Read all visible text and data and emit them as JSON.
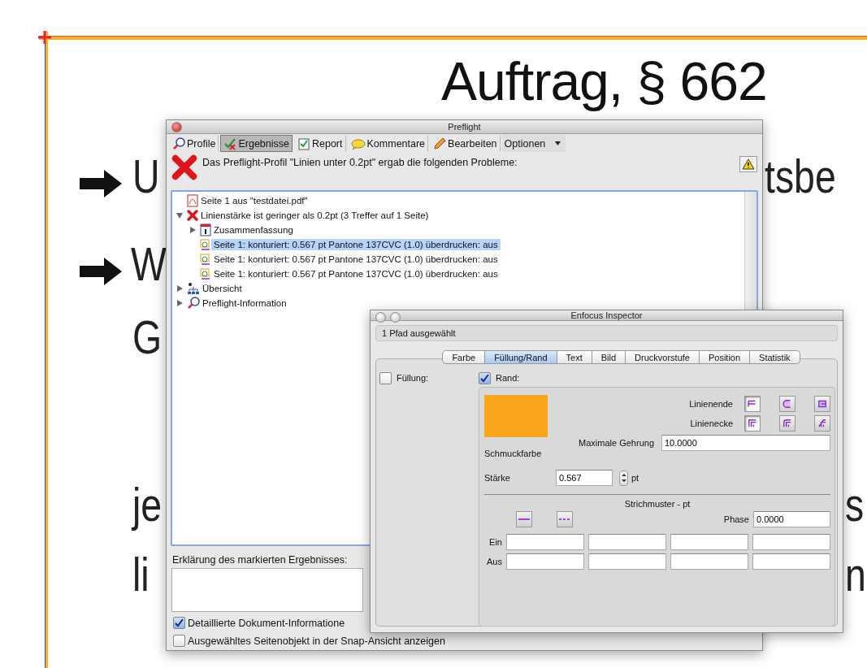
{
  "document": {
    "heading": "Auftrag, § 662",
    "fragments": [
      {
        "text": "U",
        "bullet": true
      },
      {
        "text": "tsbe",
        "bullet": false
      },
      {
        "text": "W",
        "bullet": true
      },
      {
        "text": "G",
        "bullet": false
      },
      {
        "text": "je",
        "bullet": false
      },
      {
        "text": "s",
        "bullet": false
      },
      {
        "text": "li",
        "bullet": false
      },
      {
        "text": "n",
        "bullet": false
      }
    ]
  },
  "preflight": {
    "title": "Preflight",
    "toolbar": [
      {
        "kind": "profile",
        "label": "Profile",
        "selected": false
      },
      {
        "kind": "results",
        "label": "Ergebnisse",
        "selected": true
      },
      {
        "kind": "report",
        "label": "Report",
        "selected": false
      },
      {
        "kind": "comments",
        "label": "Kommentare",
        "selected": false
      },
      {
        "kind": "edit",
        "label": "Bearbeiten",
        "selected": false
      },
      {
        "kind": "menu",
        "label": "Optionen",
        "selected": false
      }
    ],
    "message": "Das Preflight-Profil \"Linien unter 0.2pt\" ergab die folgenden Probleme:",
    "tree": [
      {
        "kind": "pdf",
        "label": "Seite 1 aus \"testdatei.pdf\"",
        "selected": false
      },
      {
        "kind": "error",
        "label": "Linienstärke ist geringer als 0.2pt (3 Treffer auf 1 Seite)",
        "selected": false,
        "expanded": true,
        "children": [
          {
            "kind": "summary",
            "label": "Zusammenfassung",
            "selected": false,
            "expanded": false
          },
          {
            "kind": "object",
            "label": "Seite 1: konturiert: 0.567 pt Pantone 137CVC (1.0) überdrucken: aus",
            "selected": true
          },
          {
            "kind": "object",
            "label": "Seite 1: konturiert: 0.567 pt Pantone 137CVC (1.0) überdrucken: aus",
            "selected": false
          },
          {
            "kind": "object",
            "label": "Seite 1: konturiert: 0.567 pt Pantone 137CVC (1.0) überdrucken: aus",
            "selected": false
          }
        ]
      },
      {
        "kind": "overview",
        "label": "Übersicht",
        "selected": false,
        "expanded": false
      },
      {
        "kind": "info",
        "label": "Preflight-Information",
        "selected": false,
        "expanded": false
      }
    ],
    "explanation_label": "Erklärung des markierten Ergebnisses:",
    "checkboxes": [
      {
        "label": "Detaillierte Dokument-Informatione",
        "checked": true
      },
      {
        "label": "Ausgewähltes Seitenobjekt in der Snap-Ansicht anzeigen",
        "checked": false
      }
    ]
  },
  "inspector": {
    "title": "Enfocus Inspector",
    "status": "1 Pfad ausgewählt",
    "tabs": [
      {
        "label": "Farbe",
        "selected": false
      },
      {
        "label": "Füllung/Rand",
        "selected": true
      },
      {
        "label": "Text",
        "selected": false
      },
      {
        "label": "Bild",
        "selected": false
      },
      {
        "label": "Druckvorstufe",
        "selected": false
      },
      {
        "label": "Position",
        "selected": false
      },
      {
        "label": "Statistik",
        "selected": false
      }
    ],
    "fill": {
      "label": "Füllung:",
      "checked": false
    },
    "stroke": {
      "label": "Rand:",
      "checked": true
    },
    "swatch": {
      "color": "#fca51a",
      "label": "Schmuckfarbe"
    },
    "line_end": {
      "label": "Linienende",
      "options": [
        {
          "selected": true
        },
        {
          "selected": false
        },
        {
          "selected": false
        }
      ]
    },
    "line_join": {
      "label": "Linienecke",
      "options": [
        {
          "selected": true
        },
        {
          "selected": false
        },
        {
          "selected": false
        }
      ]
    },
    "miter": {
      "label": "Maximale Gehrung",
      "value": "10.0000"
    },
    "weight": {
      "label": "Stärke",
      "value": "0.567",
      "unit": "pt"
    },
    "dash": {
      "heading": "Strichmuster - pt",
      "phase_label": "Phase",
      "phase": "0.0000",
      "rows": [
        {
          "label": "Ein"
        },
        {
          "label": "Aus"
        }
      ]
    }
  }
}
